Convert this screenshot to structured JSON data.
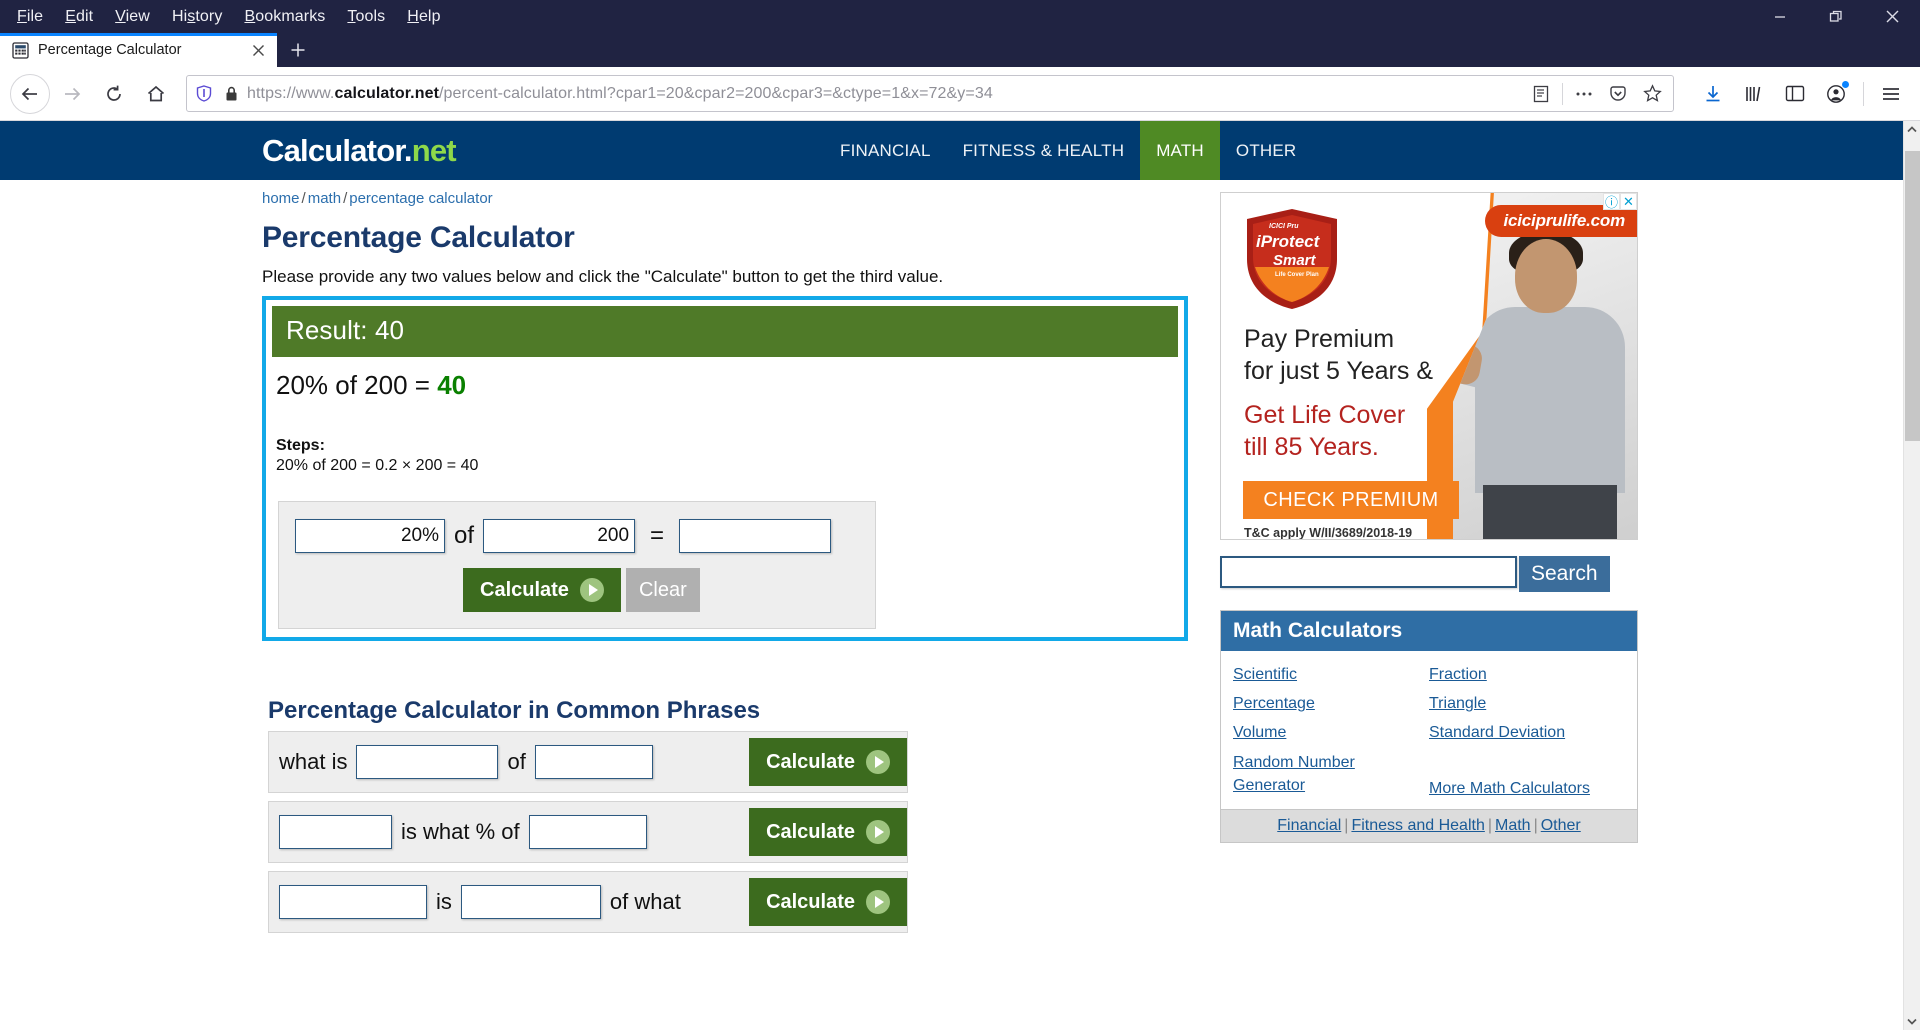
{
  "browser": {
    "menus": [
      "File",
      "Edit",
      "View",
      "History",
      "Bookmarks",
      "Tools",
      "Help"
    ],
    "window_controls": {
      "minimize": "minimize-icon",
      "restore": "restore-icon",
      "close": "close-icon"
    },
    "tab": {
      "title": "Percentage Calculator",
      "favicon": "calculator-icon",
      "close": "close-icon"
    },
    "new_tab_label": "+",
    "nav": {
      "back": "back-arrow-icon",
      "forward": "forward-arrow-icon",
      "reload": "reload-icon",
      "home": "home-icon"
    },
    "url": {
      "prefix": "https://www.",
      "domain": "calculator.net",
      "path": "/percent-calculator.html?cpar1=20&cpar2=200&cpar3=&ctype=1&x=72&y=34",
      "full": "https://www.calculator.net/percent-calculator.html?cpar1=20&cpar2=200&cpar3=&ctype=1&x=72&y=34",
      "shield_icon": "shield-icon",
      "lock_icon": "lock-icon"
    },
    "url_icons": [
      "reader-view-icon",
      "page-actions-icon",
      "pocket-icon",
      "bookmark-star-icon"
    ],
    "toolbar_icons": [
      "downloads-icon",
      "library-icon",
      "sidebar-icon",
      "account-icon",
      "menu-hamburger-icon"
    ]
  },
  "site": {
    "logo": {
      "main": "Calculator",
      "dot": ".",
      "net": "net"
    },
    "nav": [
      {
        "label": "FINANCIAL",
        "active": false
      },
      {
        "label": "FITNESS & HEALTH",
        "active": false
      },
      {
        "label": "MATH",
        "active": true
      },
      {
        "label": "OTHER",
        "active": false
      }
    ]
  },
  "breadcrumb": {
    "home": "home",
    "math": "math",
    "current": "percentage calculator",
    "sep": "/"
  },
  "main": {
    "title": "Percentage Calculator",
    "intro": "Please provide any two values below and click the \"Calculate\" button to get the third value.",
    "result_bar": "Result: 40",
    "result_expr_prefix": "20% of 200 = ",
    "result_value": "40",
    "steps_label": "Steps:",
    "steps_line": "20% of 200 = 0.2 × 200 = 40",
    "form": {
      "value1": "20%",
      "label_of": "of",
      "value2": "200",
      "label_eq": "=",
      "value3": "",
      "calculate_label": "Calculate",
      "clear_label": "Clear"
    }
  },
  "phrases": {
    "title": "Percentage Calculator in Common Phrases",
    "rows": [
      {
        "pre": "what is",
        "v1": "",
        "v1_suffix": "%",
        "mid": "of",
        "v2": "",
        "post": "",
        "button": "Calculate"
      },
      {
        "pre": "",
        "v1": "",
        "v1_suffix": "",
        "mid": "is what % of",
        "v2": "",
        "post": "",
        "button": "Calculate"
      },
      {
        "pre": "",
        "v1": "",
        "v1_suffix": "",
        "mid": "is",
        "v2": "",
        "v2_suffix": "%",
        "post": "of what",
        "button": "Calculate"
      }
    ]
  },
  "ad": {
    "brand_logo": "iProtect Smart",
    "logo_small": "ICICI Pru",
    "logo_line1": "iProtect",
    "logo_line2": "Smart",
    "logo_line3": "Life Cover Plan",
    "headline1": "Pay Premium",
    "headline2": "for just 5 Years &",
    "headline3": "Get Life Cover",
    "headline4": "till 85 Years.",
    "cta": "CHECK PREMIUM",
    "terms": "T&C apply W/II/3689/2018-19",
    "url": "iciciprulife.com",
    "info_icon": "info-icon",
    "close_icon": "close-icon"
  },
  "search": {
    "value": "",
    "placeholder": "",
    "button": "Search"
  },
  "sidebox": {
    "title": "Math Calculators",
    "col_left": [
      "Scientific",
      "Percentage",
      "Volume",
      "Random Number Generator"
    ],
    "col_right": [
      "Fraction",
      "Triangle",
      "Standard Deviation",
      "More Math Calculators"
    ],
    "footer": [
      "Financial",
      "Fitness and Health",
      "Math",
      "Other"
    ],
    "footer_sep": "|"
  },
  "colors": {
    "site_header": "#003b71",
    "nav_active": "#4f8a24",
    "result_green": "#4f7a28",
    "highlight_border": "#12a9e8",
    "result_value_green": "#0a8000",
    "button_green": "#3c6b1e",
    "sidebox_header": "#2f6ea5",
    "link_blue": "#1a5a96",
    "ad_orange": "#f4811f",
    "ad_red": "#b4231f",
    "chrome_dark": "#202342"
  }
}
